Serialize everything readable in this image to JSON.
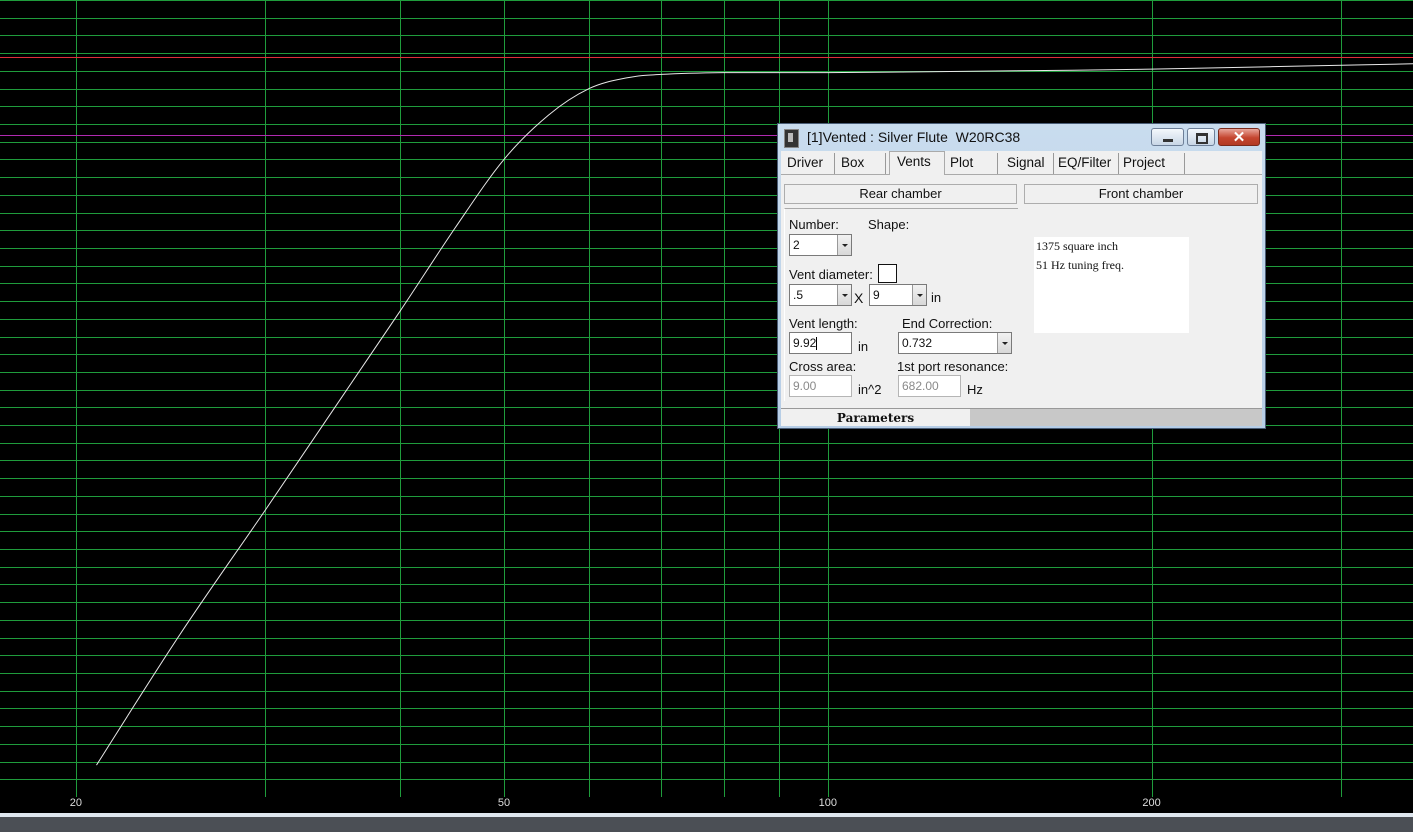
{
  "chart_data": {
    "type": "line",
    "x_scale": "log",
    "xlim": [
      17,
      350
    ],
    "ylim": [
      -40,
      5
    ],
    "x_tick_labels": [
      "20",
      "50",
      "100",
      "200"
    ],
    "grid": true,
    "grid_color": "#1f9c3c",
    "background": "#000000",
    "reference_lines": [
      {
        "y": 1.8,
        "color": "#e0303a"
      },
      {
        "y": -2.6,
        "color": "#b02ab0"
      }
    ],
    "series": [
      {
        "color": "#e8e8e8",
        "x": [
          20.9,
          25,
          30,
          35,
          40,
          45,
          50,
          55,
          60,
          65,
          70,
          80,
          100,
          150,
          200,
          350
        ],
        "y": [
          -38.2,
          -30.8,
          -23.8,
          -17.8,
          -12.6,
          -7.9,
          -4.0,
          -1.5,
          0.0,
          0.6,
          0.8,
          0.9,
          0.9,
          1.0,
          1.1,
          1.4
        ]
      }
    ]
  },
  "window": {
    "title": "[1]Vented : Silver Flute  W20RC38",
    "close_glyph": "✕"
  },
  "tabs": [
    "Driver",
    "Box",
    "Vents",
    "Plot",
    "Signal",
    "EQ/Filter",
    "Project"
  ],
  "active_tab": "Vents",
  "sections": {
    "rear": "Rear chamber",
    "front": "Front chamber"
  },
  "vents": {
    "number_label": "Number:",
    "number_value": "2",
    "shape_label": "Shape:",
    "diameter_label": "Vent diameter:",
    "diameter_a": ".5",
    "times": "X",
    "diameter_b": "9",
    "unit_in": "in",
    "length_label": "Vent length:",
    "length_value": "9.92",
    "end_corr_label": "End Correction:",
    "end_corr_value": "0.732",
    "cross_label": "Cross area:",
    "cross_value": "9.00",
    "cross_unit": "in^2",
    "resonance_label": "1st port resonance:",
    "resonance_value": "682.00",
    "resonance_unit": "Hz"
  },
  "info": {
    "line1": "1375 square inch",
    "line2": "51 Hz tuning freq."
  },
  "footer": {
    "tab_label": "Parameters"
  }
}
